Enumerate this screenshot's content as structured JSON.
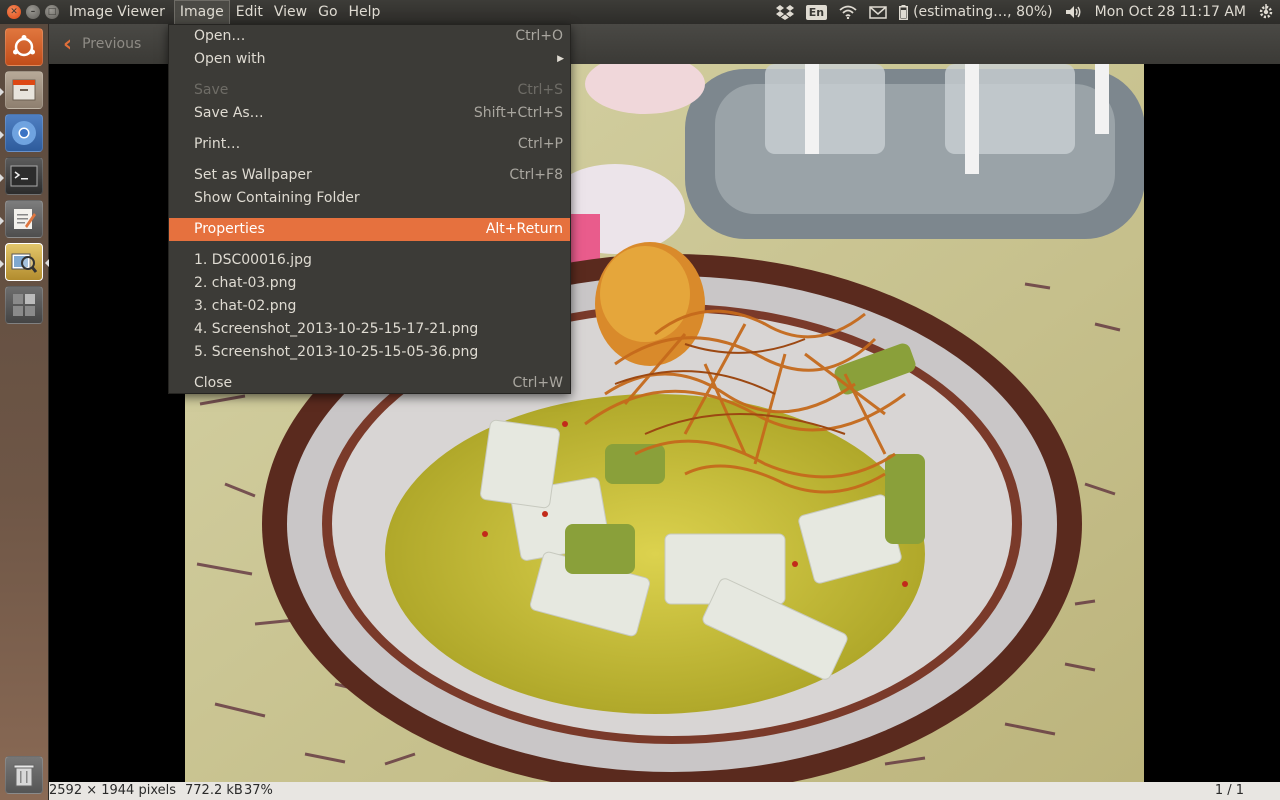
{
  "window": {
    "title": "Image Viewer"
  },
  "menubar": [
    {
      "label": "Image Viewer"
    },
    {
      "label": "Image"
    },
    {
      "label": "Edit"
    },
    {
      "label": "View"
    },
    {
      "label": "Go"
    },
    {
      "label": "Help"
    }
  ],
  "indicators": {
    "language": "En",
    "battery": "(estimating…, 80%)",
    "datetime": "Mon Oct 28  11:17 AM"
  },
  "toolbar": {
    "previous_label": "Previous"
  },
  "image_menu": {
    "open": {
      "label": "Open…",
      "shortcut": "Ctrl+O"
    },
    "open_with": {
      "label": "Open with"
    },
    "save": {
      "label": "Save",
      "shortcut": "Ctrl+S"
    },
    "save_as": {
      "label": "Save As…",
      "shortcut": "Shift+Ctrl+S"
    },
    "print": {
      "label": "Print…",
      "shortcut": "Ctrl+P"
    },
    "wallpaper": {
      "label": "Set as Wallpaper",
      "shortcut": "Ctrl+F8"
    },
    "folder": {
      "label": "Show Containing Folder"
    },
    "properties": {
      "label": "Properties",
      "shortcut": "Alt+Return"
    },
    "recent": [
      {
        "label": "1. DSC00016.jpg"
      },
      {
        "label": "2. chat-03.png"
      },
      {
        "label": "3. chat-02.png"
      },
      {
        "label": "4. Screenshot_2013-10-25-15-17-21.png"
      },
      {
        "label": "5. Screenshot_2013-10-25-15-05-36.png"
      }
    ],
    "close": {
      "label": "Close",
      "shortcut": "Ctrl+W"
    }
  },
  "statusbar": {
    "dimensions": "2592 × 1944 pixels",
    "size": "772.2 kB",
    "zoom": "37%",
    "count": "1 / 1"
  },
  "colors": {
    "accent": "#e6713e",
    "panel": "#3c3b37",
    "close": "#dd4814"
  }
}
